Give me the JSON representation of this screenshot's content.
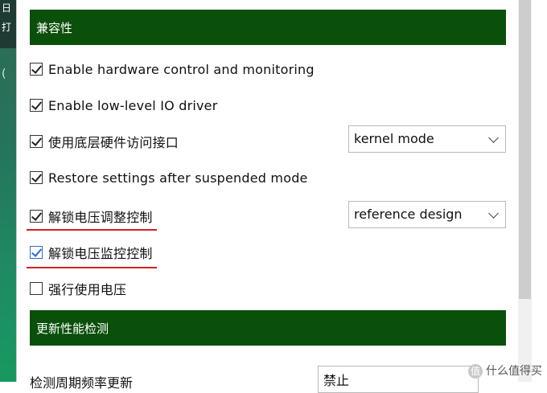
{
  "left_fragments": [
    "日",
    "打",
    "("
  ],
  "sections": [
    {
      "title": "兼容性"
    },
    {
      "title": "更新性能检测"
    }
  ],
  "options": [
    {
      "label": "Enable hardware control and monitoring",
      "checked": true
    },
    {
      "label": "Enable low-level IO driver",
      "checked": true
    },
    {
      "label": "使用底层硬件访问接口",
      "checked": true
    },
    {
      "label": "Restore settings after suspended mode",
      "checked": true
    },
    {
      "label": "解锁电压调整控制",
      "checked": true
    },
    {
      "label": "解锁电压监控控制",
      "checked": true
    },
    {
      "label": "强行使用电压",
      "checked": false
    }
  ],
  "dropdowns": {
    "io_mode": {
      "value": "kernel mode"
    },
    "voltage_design": {
      "value": "reference design"
    },
    "bottom": {
      "value": "禁止"
    }
  },
  "bottom_label": "检测周期频率更新",
  "watermark": {
    "logo": "值",
    "text": "什么值得买"
  },
  "colors": {
    "section_bg": "#0a4f0a",
    "highlight": "#d42020"
  }
}
